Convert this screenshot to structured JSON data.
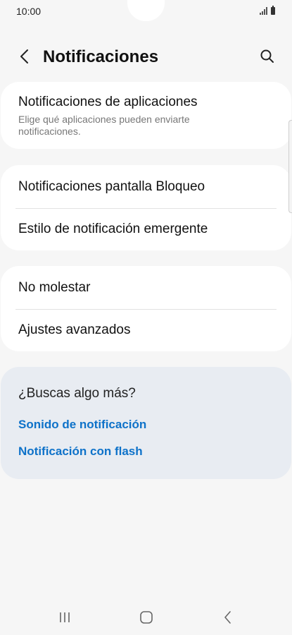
{
  "status_bar": {
    "time": "10:00"
  },
  "header": {
    "title": "Notificaciones",
    "back_icon": "chevron-left-icon",
    "search_icon": "search-icon"
  },
  "app_notifications": {
    "title": "Notificaciones de aplicaciones",
    "subtitle": "Elige qué aplicaciones pueden enviarte notificaciones."
  },
  "group_lock": {
    "items": [
      {
        "label": "Notificaciones pantalla Bloqueo"
      },
      {
        "label": "Estilo de notificación emergente"
      }
    ]
  },
  "group_advanced": {
    "items": [
      {
        "label": "No molestar"
      },
      {
        "label": "Ajustes avanzados"
      }
    ]
  },
  "suggestions": {
    "title": "¿Buscas algo más?",
    "links": [
      {
        "label": "Sonido de notificación"
      },
      {
        "label": "Notificación con flash"
      }
    ]
  },
  "colors": {
    "background": "#f6f6f6",
    "card": "#ffffff",
    "suggestion_card": "#e8ecf2",
    "link": "#0e72c9"
  }
}
